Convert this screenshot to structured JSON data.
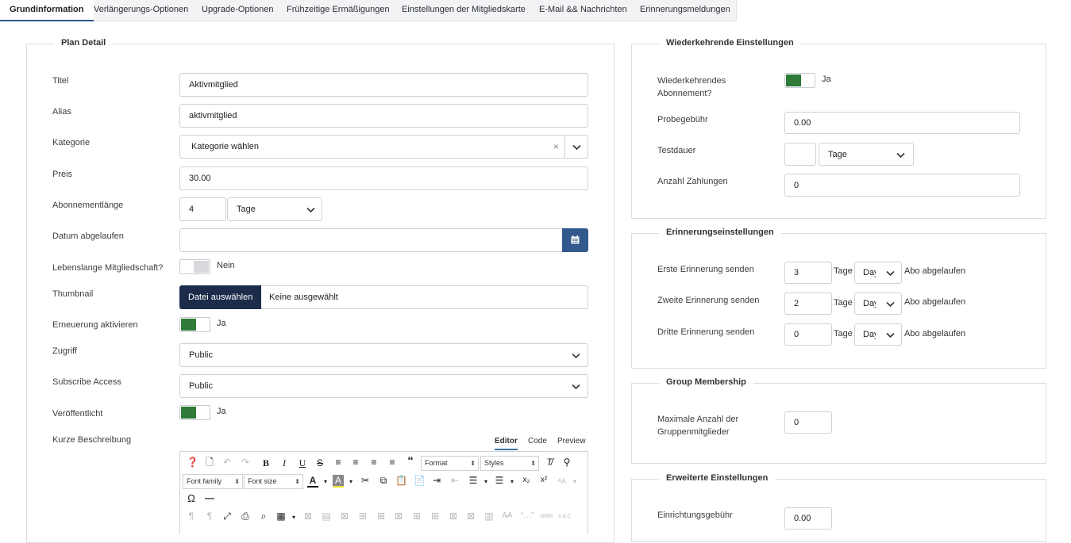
{
  "tabs": [
    {
      "label": "Grundinformation",
      "active": true
    },
    {
      "label": "Verlängerungs-Optionen"
    },
    {
      "label": "Upgrade-Optionen"
    },
    {
      "label": "Frühzeitige Ermäßigungen"
    },
    {
      "label": "Einstellungen der Mitgliedskarte"
    },
    {
      "label": "E-Mail && Nachrichten"
    },
    {
      "label": "Erinnerungsmeldungen"
    }
  ],
  "plan": {
    "legend": "Plan Detail",
    "titel_label": "Titel",
    "titel_value": "Aktivmitglied",
    "alias_label": "Alias",
    "alias_value": "aktivmitglied",
    "kategorie_label": "Kategorie",
    "kategorie_value": "Kategorie wählen",
    "kategorie_clear": "×",
    "preis_label": "Preis",
    "preis_value": "30.00",
    "abo_label": "Abonnementlänge",
    "abo_value": "4",
    "abo_unit": "Tage",
    "datum_label": "Datum abgelaufen",
    "datum_value": "",
    "lifetime_label": "Lebenslange Mitgliedschaft?",
    "lifetime_text": "Nein",
    "thumb_label": "Thumbnail",
    "thumb_button": "Datei auswählen",
    "thumb_status": "Keine ausgewählt",
    "erneuerung_label": "Erneuerung aktivieren",
    "erneuerung_text": "Ja",
    "zugriff_label": "Zugriff",
    "zugriff_value": "Public",
    "subscribe_label": "Subscribe Access",
    "subscribe_value": "Public",
    "published_label": "Veröffentlicht",
    "published_text": "Ja",
    "kurz_label": "Kurze Beschreibung",
    "editor_tabs": [
      "Editor",
      "Code",
      "Preview"
    ],
    "toolbar": {
      "format": "Format",
      "styles": "Styles",
      "font_family": "Font family",
      "font_size": "Font size"
    }
  },
  "recurring": {
    "legend": "Wiederkehrende Einstellungen",
    "wk_label": "Wiederkehrendes Abonnement?",
    "wk_text": "Ja",
    "probe_label": "Probegebühr",
    "probe_value": "0.00",
    "test_label": "Testdauer",
    "test_value": "",
    "test_unit": "Tage",
    "anzahl_label": "Anzahl Zahlungen",
    "anzahl_value": "0"
  },
  "reminder": {
    "legend": "Erinnerungseinstellungen",
    "rows": [
      {
        "label": "Erste Erinnerung senden",
        "value": "3",
        "unit": "Tage",
        "sel": "Days",
        "suffix": "Abo abgelaufen"
      },
      {
        "label": "Zweite Erinnerung senden",
        "value": "2",
        "unit": "Tage",
        "sel": "Days",
        "suffix": "Abo abgelaufen"
      },
      {
        "label": "Dritte Erinnerung senden",
        "value": "0",
        "unit": "Tage",
        "sel": "Days",
        "suffix": "Abo abgelaufen"
      }
    ]
  },
  "group": {
    "legend": "Group Membership",
    "max_label": "Maximale Anzahl der Gruppenmitglieder",
    "max_value": "0"
  },
  "advanced": {
    "legend": "Erweiterte Einstellungen",
    "fee_label": "Einrichtungsgebühr",
    "fee_value": "0.00"
  },
  "colors": {
    "toggle_on": "#2f7a36",
    "primary_dark": "#1c2c4a",
    "accent_blue": "#32598d"
  }
}
